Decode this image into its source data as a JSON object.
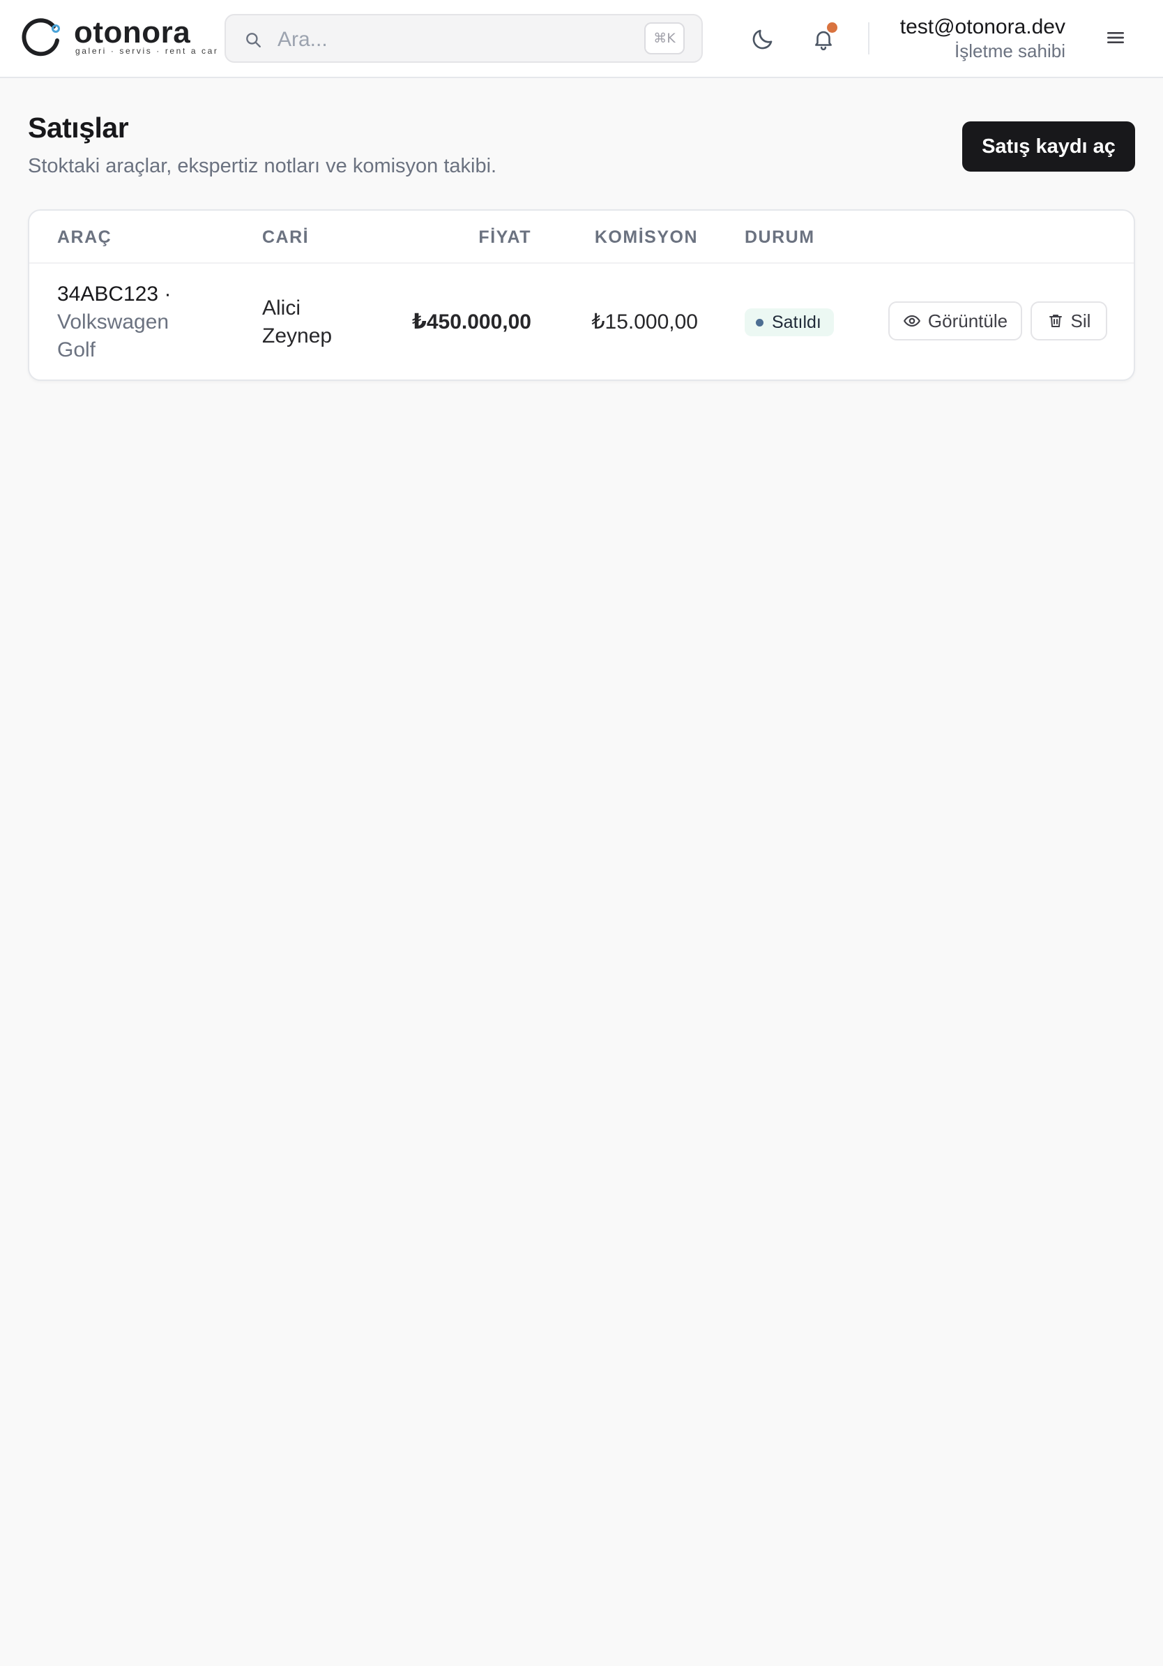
{
  "brand": {
    "name": "otonora",
    "tagline": "galeri · servis · rent a car"
  },
  "search": {
    "placeholder": "Ara...",
    "value": "",
    "shortcut": "⌘K"
  },
  "user": {
    "email": "test@otonora.dev",
    "role": "İşletme sahibi"
  },
  "notifications": {
    "has_unread": true,
    "dot_color": "#d9733f"
  },
  "page": {
    "title": "Satışlar",
    "subtitle": "Stoktaki araçlar, ekspertiz notları ve komisyon takibi.",
    "primary_action": "Satış kaydı aç"
  },
  "table": {
    "columns": [
      "ARAÇ",
      "CARİ",
      "FİYAT",
      "KOMİSYON",
      "DURUM"
    ],
    "rows": [
      {
        "plate": "34ABC123 ·",
        "model": "Volkswagen Golf",
        "cari": "Alici Zeynep",
        "fiyat": "₺450.000,00",
        "komisyon": "₺15.000,00",
        "status": "Satıldı",
        "actions": {
          "view": "Görüntüle",
          "delete": "Sil"
        }
      }
    ]
  },
  "colors": {
    "primary_button": "#18181b",
    "status_badge_bg": "#ecf8f3",
    "status_dot": "#4d6e92",
    "logo_accent": "#4aa3d8"
  },
  "icons": [
    "search-icon",
    "moon-icon",
    "bell-icon",
    "menu-icon",
    "eye-icon",
    "trash-icon"
  ]
}
